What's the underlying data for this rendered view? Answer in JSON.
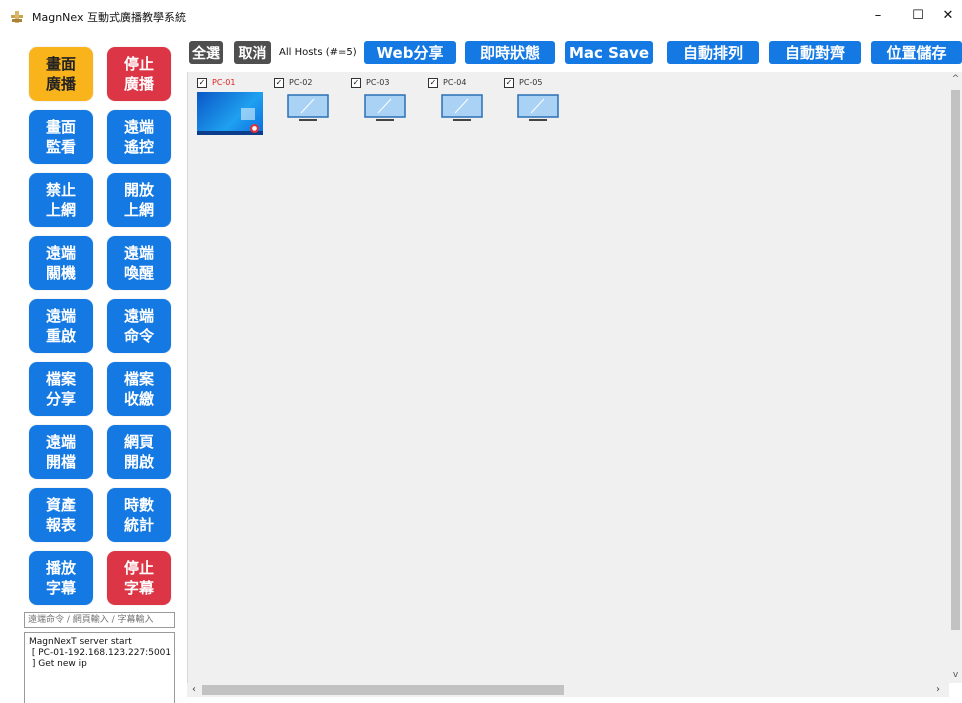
{
  "window": {
    "title": "MagnNex 互動式廣播教學系統",
    "minimize": "–",
    "maximize": "☐",
    "close": "✕"
  },
  "left_panel": {
    "buttons": [
      {
        "label": "畫面\n廣播",
        "color": "orange"
      },
      {
        "label": "停止\n廣播",
        "color": "red"
      },
      {
        "label": "畫面\n監看",
        "color": "blue"
      },
      {
        "label": "遠端\n遙控",
        "color": "blue"
      },
      {
        "label": "禁止\n上網",
        "color": "blue"
      },
      {
        "label": "開放\n上網",
        "color": "blue"
      },
      {
        "label": "遠端\n關機",
        "color": "blue"
      },
      {
        "label": "遠端\n喚醒",
        "color": "blue"
      },
      {
        "label": "遠端\n重啟",
        "color": "blue"
      },
      {
        "label": "遠端\n命令",
        "color": "blue"
      },
      {
        "label": "檔案\n分享",
        "color": "blue"
      },
      {
        "label": "檔案\n收繳",
        "color": "blue"
      },
      {
        "label": "遠端\n開檔",
        "color": "blue"
      },
      {
        "label": "網頁\n開啟",
        "color": "blue"
      },
      {
        "label": "資產\n報表",
        "color": "blue"
      },
      {
        "label": "時數\n統計",
        "color": "blue"
      },
      {
        "label": "播放\n字幕",
        "color": "blue"
      },
      {
        "label": "停止\n字幕",
        "color": "red"
      }
    ],
    "command_placeholder": "遠端命令 / 網頁輸入 / 字幕輸入",
    "log": "MagnNexT server start\n [ PC-01-192.168.123.227:5001\n ] Get new ip"
  },
  "toolbar": {
    "select_all": "全選",
    "cancel": "取消",
    "hosts_label": "All Hosts (#=5)",
    "web_share": "Web分享",
    "instant_status": "即時狀態",
    "mac_save": "Mac Save",
    "auto_arrange": "自動排列",
    "auto_align": "自動對齊",
    "position_save": "位置儲存"
  },
  "hosts": [
    {
      "name": "PC-01",
      "checked": true,
      "online": true
    },
    {
      "name": "PC-02",
      "checked": true,
      "online": false
    },
    {
      "name": "PC-03",
      "checked": true,
      "online": false
    },
    {
      "name": "PC-04",
      "checked": true,
      "online": false
    },
    {
      "name": "PC-05",
      "checked": true,
      "online": false
    }
  ],
  "colors": {
    "orange": "#f9b31b",
    "red": "#dc3545",
    "blue": "#1479e3",
    "dark": "#4f4f4f",
    "online_name": "#e02020"
  }
}
